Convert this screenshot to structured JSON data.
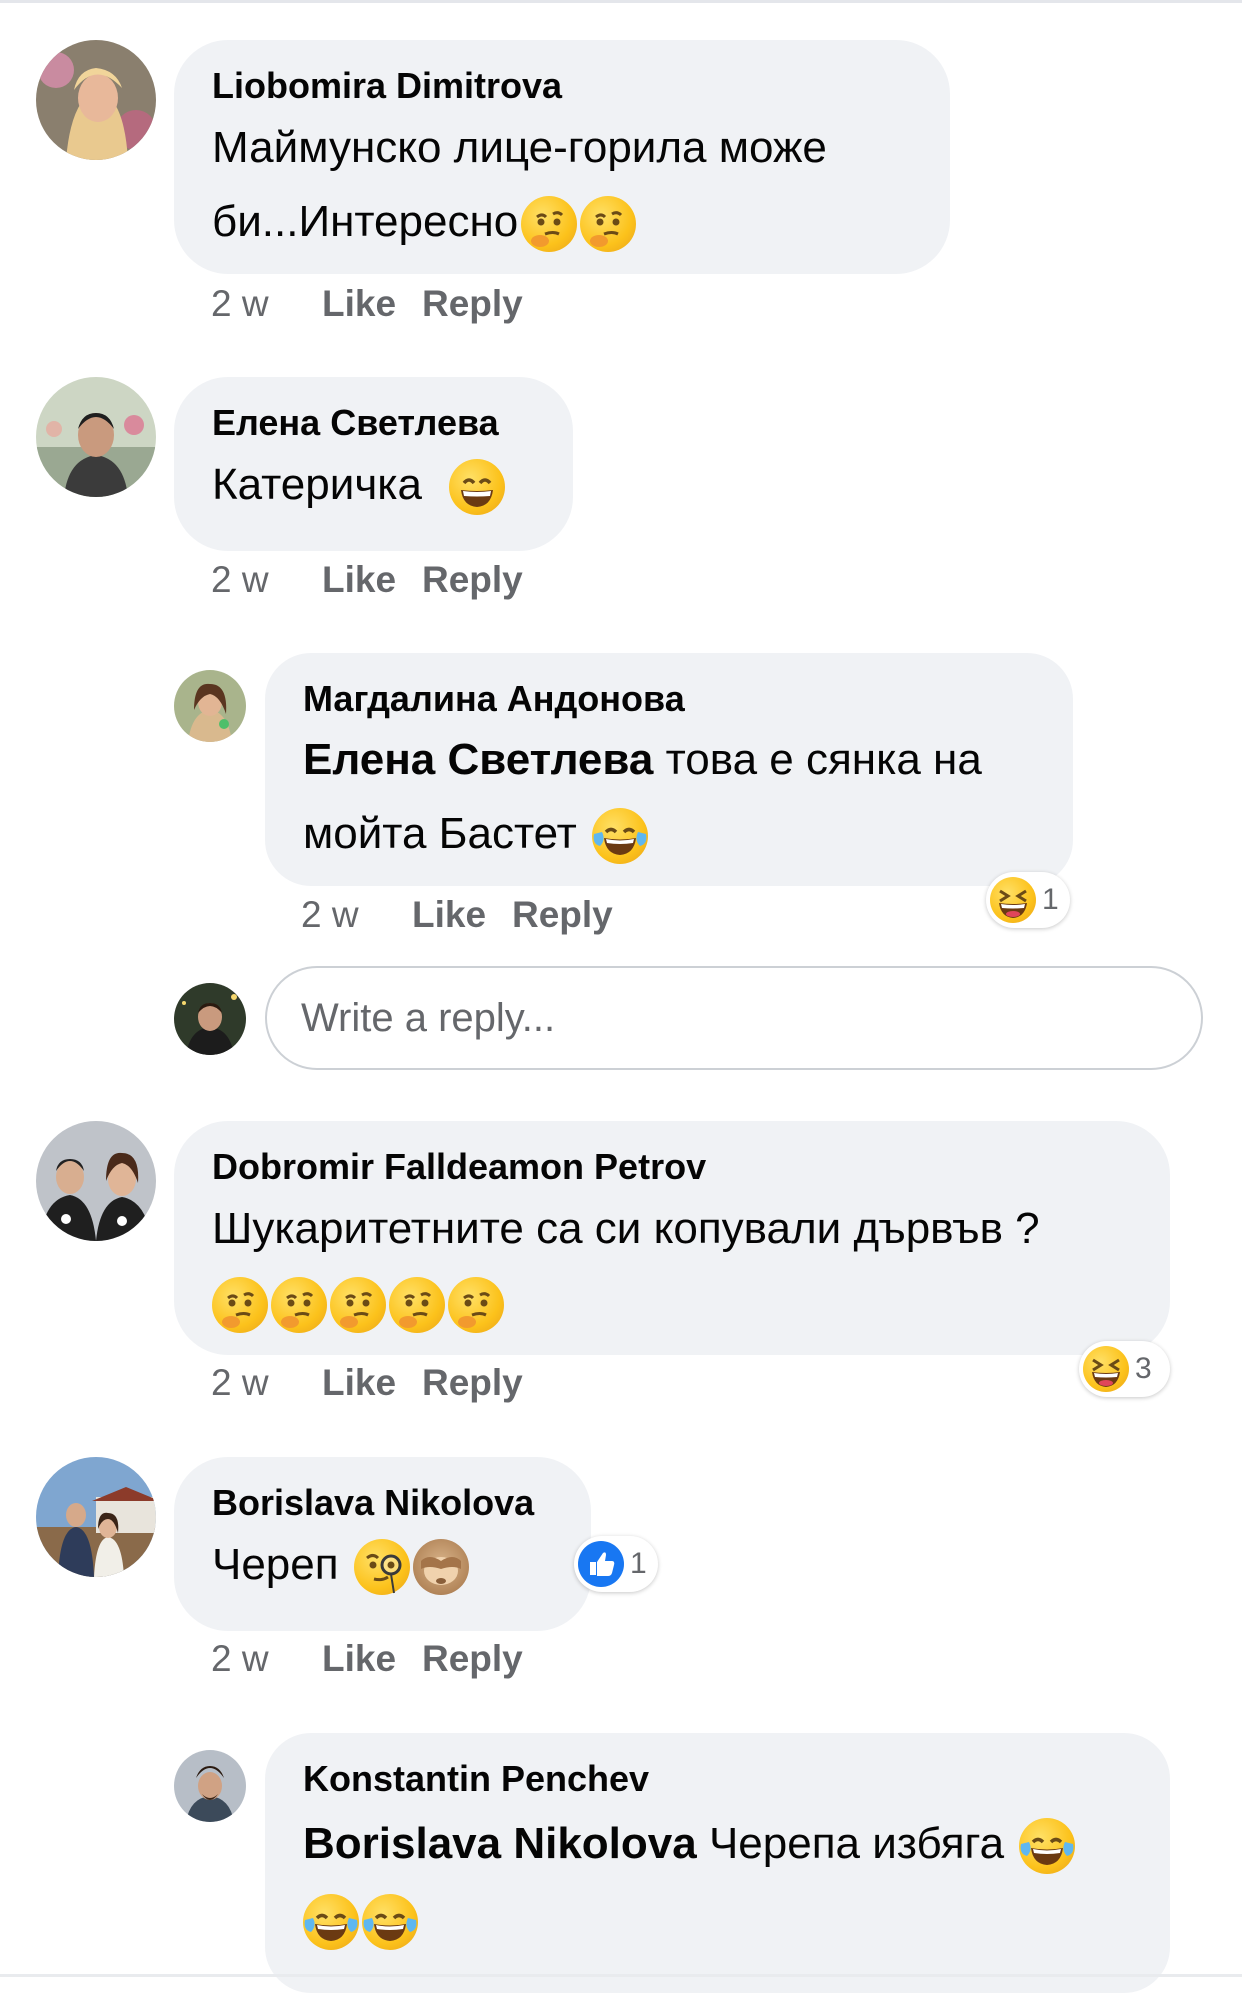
{
  "comments": [
    {
      "author": "Liobomira Dimitrova",
      "text": "Маймунско лице-горила може",
      "text2": "би...Интересно",
      "time": "2 w",
      "like": "Like",
      "reply": "Reply"
    },
    {
      "author": "Елена Светлева",
      "text": "Катеричка",
      "time": "2 w",
      "like": "Like",
      "reply": "Reply"
    },
    {
      "author": "Магдалина Андонова",
      "mention": "Елена Светлева",
      "text": " това е сянка на",
      "text2": "мойта Бастет",
      "time": "2 w",
      "like": "Like",
      "reply": "Reply",
      "reaction_count": "1"
    },
    {
      "author": "Dobromir Falldeamon Petrov",
      "text": "Шукаритетните са си копували дървъв ?",
      "time": "2 w",
      "like": "Like",
      "reply": "Reply",
      "reaction_count": "3"
    },
    {
      "author": "Borislava Nikolova",
      "text": "Череп",
      "time": "2 w",
      "like": "Like",
      "reply": "Reply",
      "reaction_count": "1"
    },
    {
      "author": "Konstantin Penchev",
      "mention": "Borislava Nikolova",
      "text": " Черепа избяга"
    }
  ],
  "reply_box": {
    "placeholder": "Write a reply..."
  },
  "icons": {
    "thinking": "thinking-face-emoji",
    "grin": "grinning-face-emoji",
    "joy": "tears-of-joy-emoji",
    "laugh": "squinting-laughing-emoji",
    "monocle": "monocle-face-emoji",
    "see_no_evil": "see-no-evil-monkey-emoji",
    "like": "thumbs-up-icon"
  },
  "colors": {
    "bubble": "#f0f2f5",
    "meta_text": "#65676b",
    "like_blue": "#1877f2"
  }
}
